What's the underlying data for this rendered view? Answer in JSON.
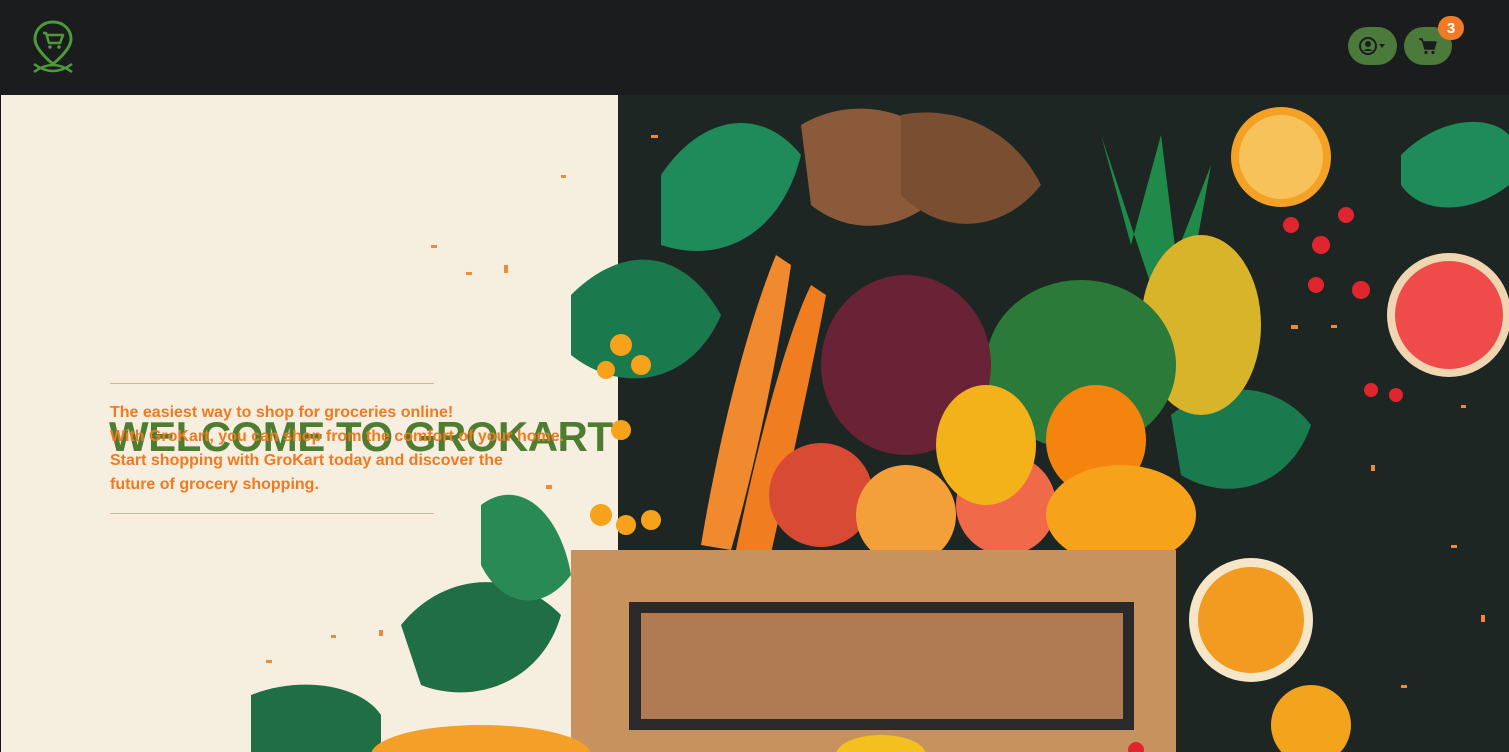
{
  "brand": {
    "logo_icon": "shopping-cart-location-pin-icon",
    "accent_color": "#4e7d32",
    "orange_color": "#f07a1f"
  },
  "navbar": {
    "user_icon": "user-circle-icon",
    "dropdown_icon": "caret-down-icon",
    "cart_icon": "shopping-cart-icon",
    "cart_count": "3"
  },
  "hero": {
    "title": "WELCOME TO GROKART",
    "lines": [
      "The easiest way to shop for groceries online!",
      "With GroKart, you can shop from the comfort of your home.",
      "Start shopping with GroKart today and discover the",
      "future of grocery shopping."
    ]
  }
}
